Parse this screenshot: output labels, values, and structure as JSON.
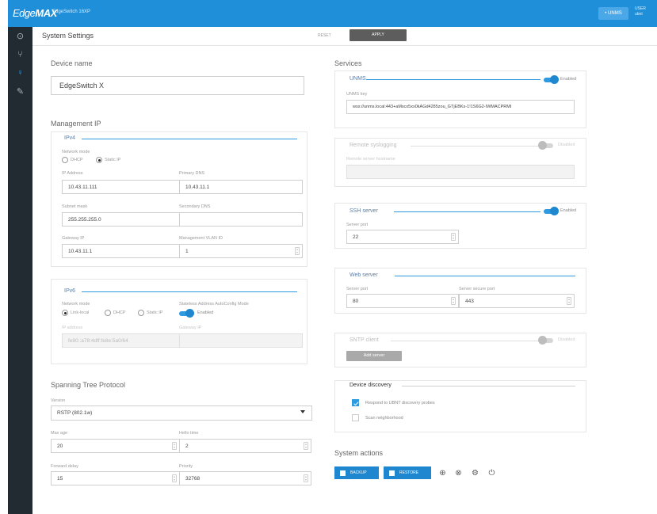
{
  "topbar": {
    "logo_main": "Edge",
    "logo_bold": "MAX",
    "subtitle": "EdgeSwitch 16XP",
    "unms_label": "• UNMS",
    "user_line1": "USER",
    "user_line2": "ubnt"
  },
  "sidebar": {
    "icons": [
      "dashboard-icon",
      "topology-icon",
      "system-icon",
      "tools-icon"
    ],
    "active_index": 2
  },
  "header": {
    "title": "System Settings",
    "reset_label": "RESET",
    "apply_label": "APPLY"
  },
  "device_name": {
    "section_title": "Device name",
    "value": "EdgeSwitch X"
  },
  "management_ip": {
    "section_title": "Management IP",
    "ipv4": {
      "title": "IPv4",
      "network_mode_label": "Network mode",
      "modes": [
        "DHCP",
        "Static IP"
      ],
      "selected_mode": "Static IP",
      "ip_address_label": "IP Address",
      "ip_address": "10.43.11.111",
      "primary_dns_label": "Primary DNS",
      "primary_dns": "10.43.11.1",
      "subnet_mask_label": "Subnet mask",
      "subnet_mask": "255.255.255.0",
      "secondary_dns_label": "Secondary DNS",
      "secondary_dns": "",
      "gateway_label": "Gateway IP",
      "gateway": "10.43.11.1",
      "vlan_label": "Management VLAN ID",
      "vlan": "1"
    },
    "ipv6": {
      "title": "IPv6",
      "network_mode_label": "Network mode",
      "modes": [
        "Link-local",
        "DHCP",
        "Static IP"
      ],
      "selected_mode": "Link-local",
      "slaac_label": "Stateless Address AutoConfig Mode",
      "slaac_state": "Enabled",
      "ip_label": "IP address",
      "ip_value": "fe80::a78:4dff:fe8e:5a0/64",
      "gateway_label": "Gateway IP",
      "gateway_value": ""
    }
  },
  "stp": {
    "section_title": "Spanning Tree Protocol",
    "version_label": "Version",
    "version": "RSTP (802.1w)",
    "max_age_label": "Max age",
    "max_age": "20",
    "hello_time_label": "Hello time",
    "hello_time": "2",
    "forward_delay_label": "Forward delay",
    "forward_delay": "15",
    "priority_label": "Priority",
    "priority": "32768"
  },
  "services": {
    "section_title": "Services",
    "unms": {
      "title": "UNMS",
      "state": "Enabled",
      "key_label": "UNMS key",
      "key_value": "wss://unms.local:443+aMscx5xx0kAGd4285zou_GTjEBKs-1!1S6G2-IWMACPRMI"
    },
    "remote_syslog": {
      "title": "Remote syslogging",
      "state": "Disabled",
      "server_label": "Remote server hostname",
      "server_value": ""
    },
    "ssh": {
      "title": "SSH server",
      "state": "Enabled",
      "port_label": "Server port",
      "port": "22"
    },
    "web": {
      "title": "Web server",
      "port_label": "Server port",
      "port": "80",
      "secure_port_label": "Server secure port",
      "secure_port": "443"
    },
    "sntp": {
      "title": "SNTP client",
      "state": "Disabled",
      "add_server_label": "Add server"
    },
    "discovery": {
      "title": "Device discovery",
      "respond_label": "Respond to UBNT discovery probes",
      "respond_checked": true,
      "scan_label": "Scan neighborhood",
      "scan_checked": false
    }
  },
  "system_actions": {
    "section_title": "System actions",
    "backup_label": "BACKUP",
    "restore_label": "RESTORE",
    "icons": [
      "locate-icon",
      "reset-defaults-icon",
      "settings-gear-icon",
      "power-icon"
    ]
  },
  "colors": {
    "topbar": "#1f8fd9",
    "sidebar": "#232b32",
    "accent": "#2e9ae0",
    "apply_button": "#5d5d5d"
  }
}
